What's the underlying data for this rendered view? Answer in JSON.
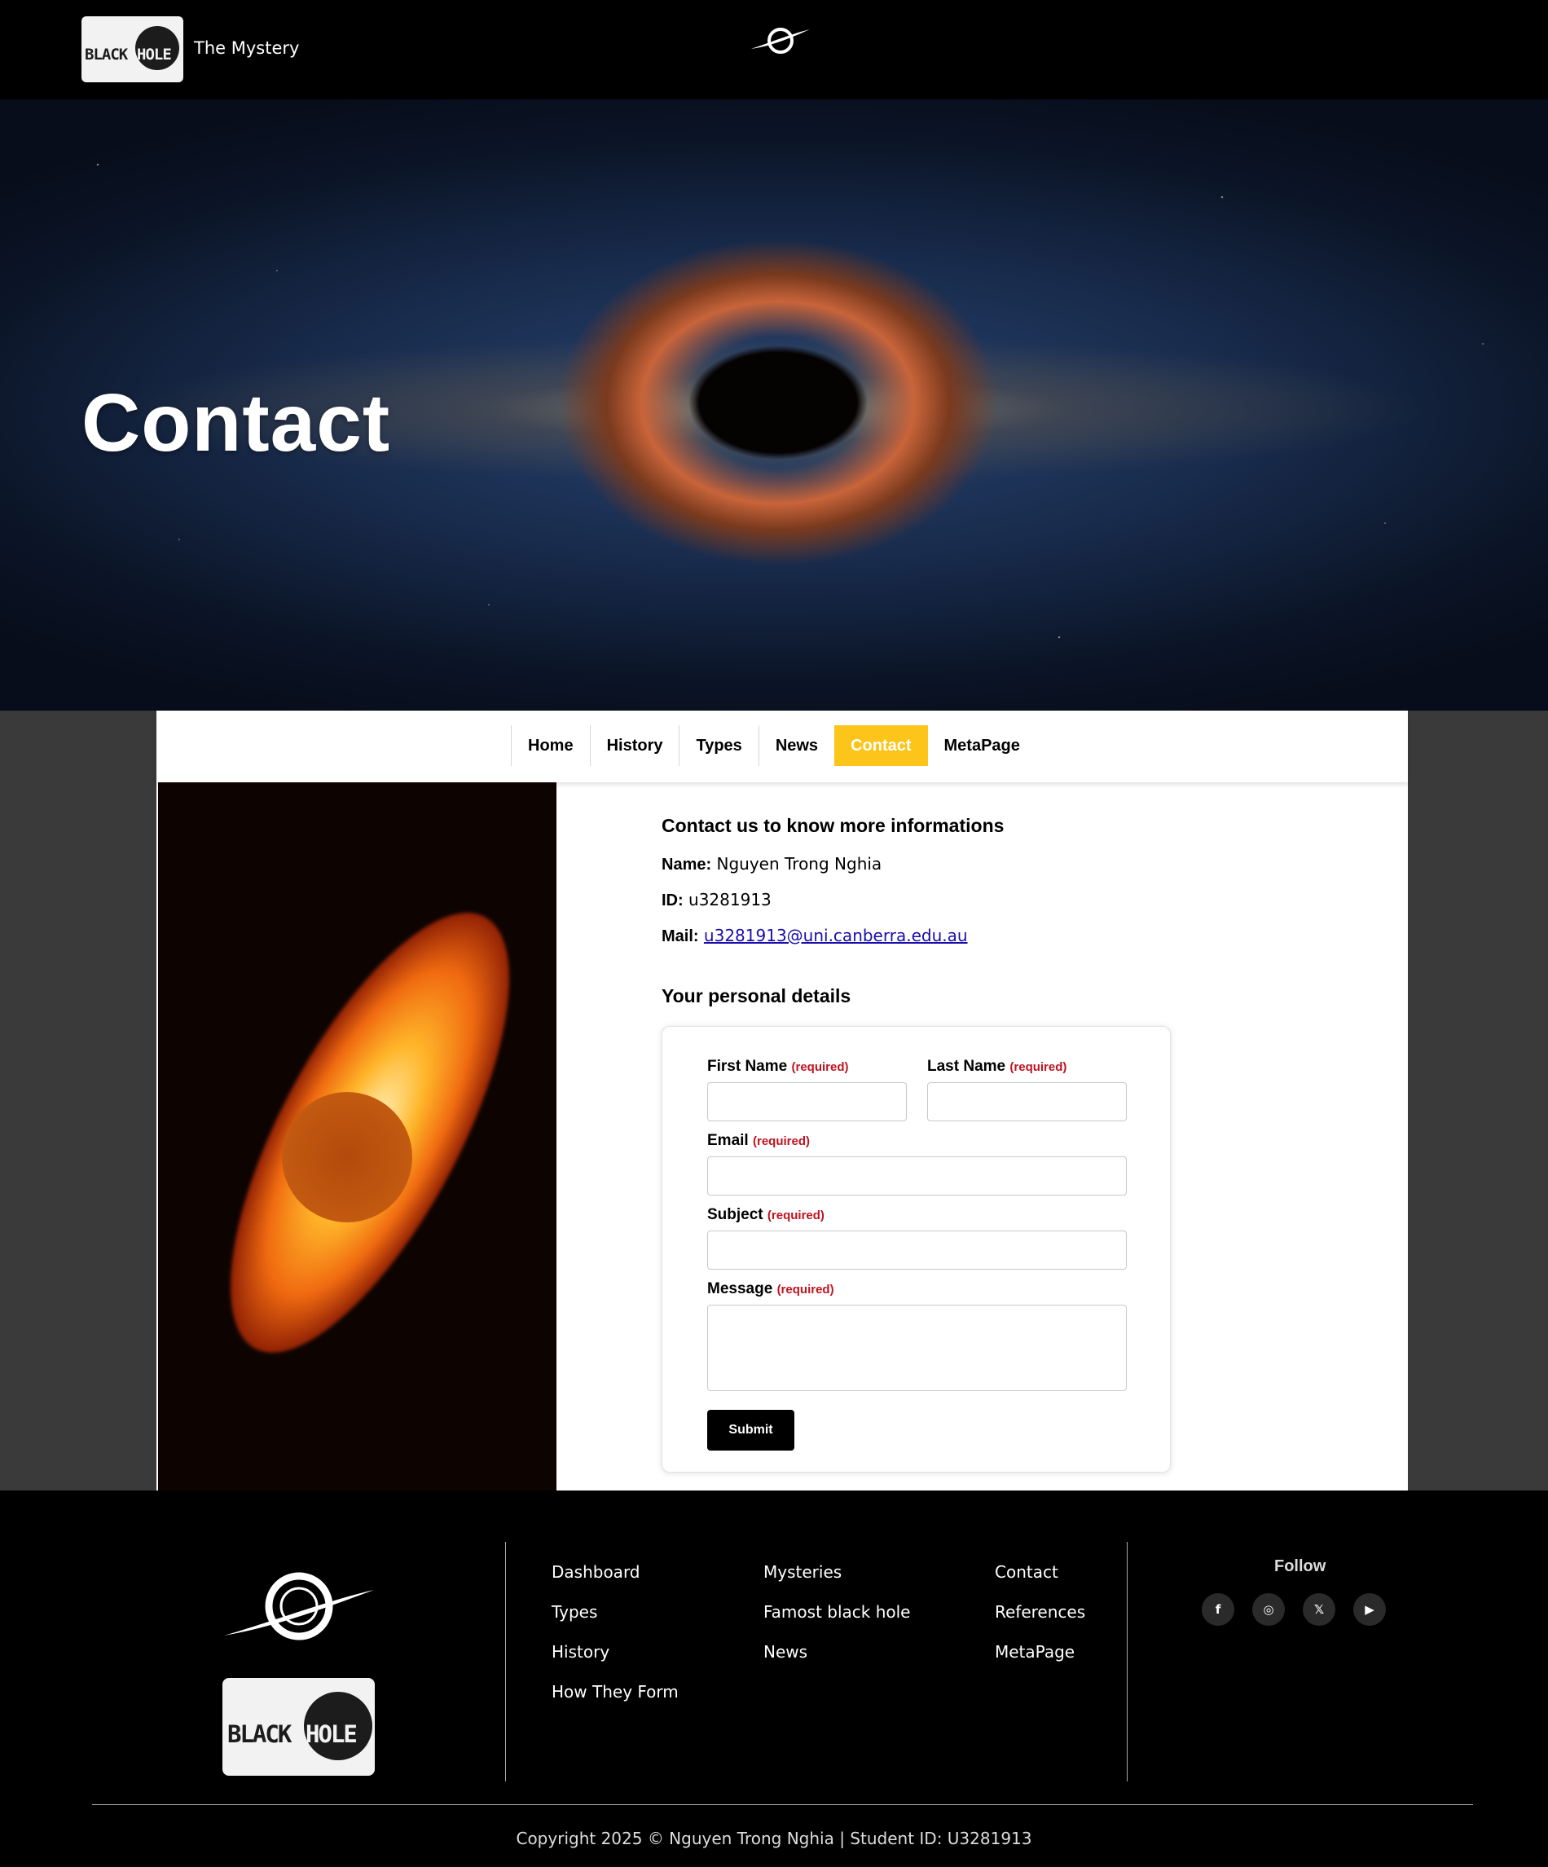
{
  "header": {
    "logo_word_1": "BLACK",
    "logo_word_2": "HOLE",
    "tagline": "The Mystery"
  },
  "hero": {
    "title": "Contact"
  },
  "nav": {
    "items": [
      {
        "label": "Home"
      },
      {
        "label": "History"
      },
      {
        "label": "Types"
      },
      {
        "label": "News"
      },
      {
        "label": "Contact",
        "active": true
      },
      {
        "label": "MetaPage"
      }
    ],
    "active_color": "#fdc41a"
  },
  "contact": {
    "heading": "Contact us to know more informations",
    "name_label": "Name:",
    "name_value": "Nguyen Trong Nghia",
    "id_label": "ID:",
    "id_value": "u3281913",
    "mail_label": "Mail:",
    "mail_value": "u3281913@uni.canberra.edu.au"
  },
  "form": {
    "heading": "Your personal details",
    "required_text": "(required)",
    "first_name_label": "First Name",
    "first_name_value": "",
    "last_name_label": "Last Name",
    "last_name_value": "",
    "email_label": "Email",
    "email_value": "",
    "subject_label": "Subject",
    "subject_value": "",
    "message_label": "Message",
    "message_value": "",
    "submit_label": "Submit",
    "required_color": "#c1121f"
  },
  "footer": {
    "logo_word_1": "BLACK",
    "logo_word_2": "HOLE",
    "col1": [
      "Dashboard",
      "Types",
      "History",
      "How They Form"
    ],
    "col2": [
      "Mysteries",
      "Famost black hole",
      "News"
    ],
    "col3": [
      "Contact",
      "References",
      "MetaPage"
    ],
    "follow_label": "Follow",
    "socials": [
      {
        "icon": "facebook-icon",
        "glyph": "f"
      },
      {
        "icon": "instagram-icon",
        "glyph": "◎"
      },
      {
        "icon": "x-icon",
        "glyph": "𝕏"
      },
      {
        "icon": "youtube-icon",
        "glyph": "▶"
      }
    ],
    "copyright": "Copyright 2025 © Nguyen Trong Nghia | Student ID: U3281913"
  }
}
